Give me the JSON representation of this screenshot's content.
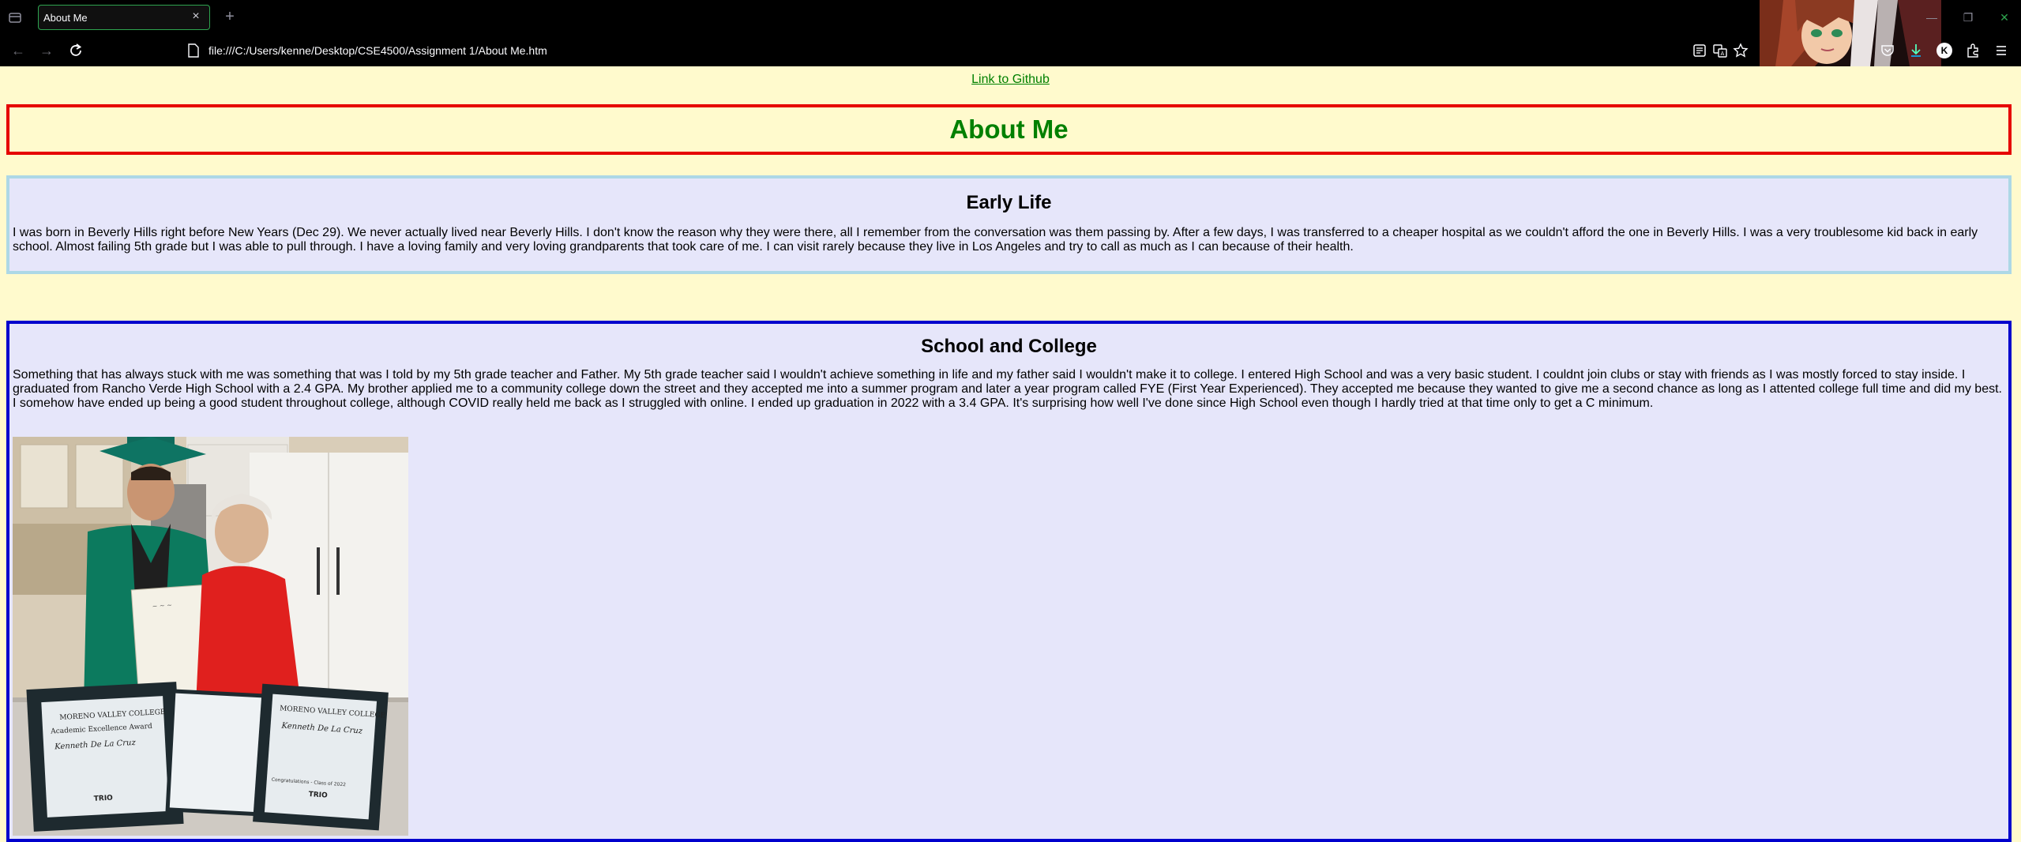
{
  "browser": {
    "tab_title": "About Me",
    "url": "file:///C:/Users/kenne/Desktop/CSE4500/Assignment 1/About Me.htm",
    "profile_initial": "K",
    "icons": [
      "tab-list-icon",
      "close-icon",
      "new-tab-icon",
      "back-icon",
      "forward-icon",
      "reload-icon",
      "page-icon",
      "reader-view-icon",
      "translate-icon",
      "bookmark-star-icon",
      "pocket-icon",
      "downloads-icon",
      "account-icon",
      "extensions-icon",
      "menu-icon",
      "minimize-icon",
      "restore-icon",
      "close-window-icon"
    ]
  },
  "page": {
    "link_text": "Link to Github",
    "title": "About Me",
    "sections": [
      {
        "heading": "Early Life",
        "text": "I was born in Beverly Hills right before New Years (Dec 29). We never actually lived near Beverly Hills. I don't know the reason why they were there, all I remember from the conversation was them passing by. After a few days, I was transferred to a cheaper hospital as we couldn't afford the one in Beverly Hills. I was a very troublesome kid back in early school. Almost failing 5th grade but I was able to pull through. I have a loving family and very loving grandparents that took care of me. I can visit rarely because they live in Los Angeles and try to call as much as I can because of their health."
      },
      {
        "heading": "School and College",
        "text": "Something that has always stuck with me was something that was I told by my 5th grade teacher and Father. My 5th grade teacher said I wouldn't achieve something in life and my father said I wouldn't make it to college. I entered High School and was a very basic student. I couldnt join clubs or stay with friends as I was mostly forced to stay inside. I graduated from Rancho Verde High School with a 2.4 GPA. My brother applied me to a community college down the street and they accepted me into a summer program and later a year program called FYE (First Year Experienced). They accepted me because they wanted to give me a second chance as long as I attented college full time and did my best. I somehow have ended up being a good student throughout college, although COVID really held me back as I struggled with online. I ended up graduation in 2022 with a 3.4 GPA. It's surprising how well I've done since High School even though I hardly tried at that time only to get a C minimum."
      }
    ],
    "photo": {
      "certificate_left": [
        "MORENO VALLEY COLLEGE",
        "Academic Excellence Award",
        "Kenneth De La Cruz",
        "TRIO"
      ],
      "certificate_right": [
        "MORENO VALLEY COLLEGE",
        "Kenneth De La Cruz",
        "Congratulations - Class of 2022",
        "TRIO"
      ]
    }
  },
  "colors": {
    "page_background": "#fffacd",
    "link_and_title": "#008000",
    "about_border": "#e60000",
    "early_border": "#add8e6",
    "section_background": "#e6e6fa",
    "school_border": "#0000cd"
  }
}
